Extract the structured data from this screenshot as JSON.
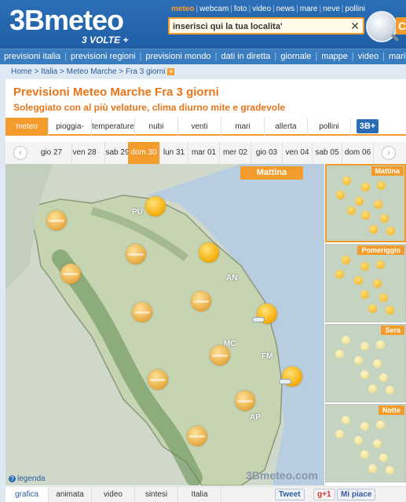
{
  "header": {
    "logo_main": "3Bmeteo",
    "logo_sub": "3 VOLTE +",
    "toplinks": [
      "meteo",
      "webcam",
      "foto",
      "video",
      "news",
      "mare",
      "neve",
      "pollini"
    ],
    "search_placeholder": "inserisci qui la tua localita'",
    "search_go": "C"
  },
  "mainnav": [
    "previsioni italia",
    "previsioni regioni",
    "previsioni mondo",
    "dati in diretta",
    "giornale",
    "mappe",
    "video",
    "mari e"
  ],
  "breadcrumb": [
    "Home",
    "Italia",
    "Meteo Marche",
    "Fra 3 giorni"
  ],
  "page": {
    "title": "Previsioni Meteo Marche Fra 3 giorni",
    "subtitle": "Soleggiato con al più velature, clima diurno mite e gradevole"
  },
  "type_tabs": [
    "meteo",
    "pioggia-neve",
    "temperature",
    "nubi",
    "venti",
    "mari",
    "allerta",
    "pollini"
  ],
  "badge": "3B+",
  "days": [
    "gio 27",
    "ven 28",
    "sab 29",
    "dom 30",
    "lun 31",
    "mar 01",
    "mer 02",
    "gio 03",
    "ven 04",
    "sab 05",
    "dom 06"
  ],
  "selected_day": "dom 30",
  "map": {
    "period": "Mattina",
    "labels": [
      "PU",
      "AN",
      "MC",
      "FM",
      "AP"
    ],
    "watermark": "3Bmeteo.com",
    "legend": "legenda"
  },
  "thumbnails": [
    "Mattina",
    "Pomeriggio",
    "Sera",
    "Notte"
  ],
  "bottom_tabs": [
    "grafica",
    "animata",
    "video",
    "sintesi",
    "Italia"
  ],
  "share": {
    "tweet": "Tweet",
    "gplus": "g+1",
    "fb": "Mi piace"
  },
  "colors": {
    "accent": "#f39c2b",
    "header_blue": "#2b6fb6",
    "title_orange": "#e8751a"
  }
}
